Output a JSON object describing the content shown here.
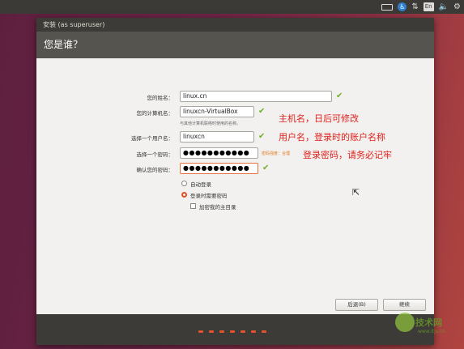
{
  "top_panel": {
    "keyboard_icon": "keyboard-icon",
    "accessibility_icon": "accessibility-icon",
    "network_icon": "network-arrows-icon",
    "language_label": "En",
    "volume_icon": "volume-icon",
    "power_icon": "gear-icon"
  },
  "window": {
    "title": "安装 (as superuser)",
    "header": "您是谁？"
  },
  "form": {
    "name_label": "您的姓名：",
    "name_value": "linux.cn",
    "computer_label": "您的计算机名：",
    "computer_value": "linuxcn-VirtualBox",
    "computer_hint": "与其他计算机联络时使用的名称。",
    "username_label": "选择一个用户名：",
    "username_value": "linuxcn",
    "password_label": "选择一个密码：",
    "password_value": "●●●●●●●●●●●",
    "password_strength": "密码强度：合理",
    "confirm_label": "确认您的密码：",
    "confirm_value": "●●●●●●●●●●●",
    "check_mark": "✔"
  },
  "options": {
    "auto_login": "自动登录",
    "require_password": "登录时需要密码",
    "encrypt_home": "加密我的主目录"
  },
  "annotations": {
    "hostname_note": "主机名，日后可修改",
    "username_note": "用户名，登录时的账户名称",
    "password_note": "登录密码，请务必记牢"
  },
  "buttons": {
    "back": "后退(B)",
    "continue": "继续"
  },
  "watermark": {
    "brand": "技术网",
    "url": "www.itjs.cn"
  },
  "colors": {
    "accent": "#e2532b",
    "check_green": "#6fb02a",
    "annotation_red": "#e0201b"
  }
}
